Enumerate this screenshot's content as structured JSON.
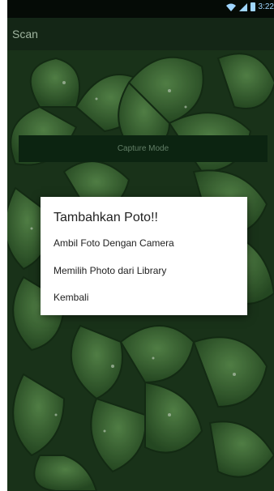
{
  "status_bar": {
    "time": "3:22",
    "icons": [
      "wifi-icon",
      "signal-icon",
      "battery-icon"
    ],
    "icon_color": "#9fd6ff"
  },
  "action_bar": {
    "title": "Scan"
  },
  "capture": {
    "label": "Capture Mode"
  },
  "dialog": {
    "title": "Tambahkan Poto!!",
    "items": [
      {
        "label": "Ambil Foto Dengan Camera"
      },
      {
        "label": "Memilih Photo dari Library"
      },
      {
        "label": "Kembali"
      }
    ]
  },
  "colors": {
    "wallpaper_leaf": "#3e6f37",
    "wallpaper_dark": "#0f2411",
    "action_bar": "#142616",
    "capture_button": "#0e2a14"
  }
}
